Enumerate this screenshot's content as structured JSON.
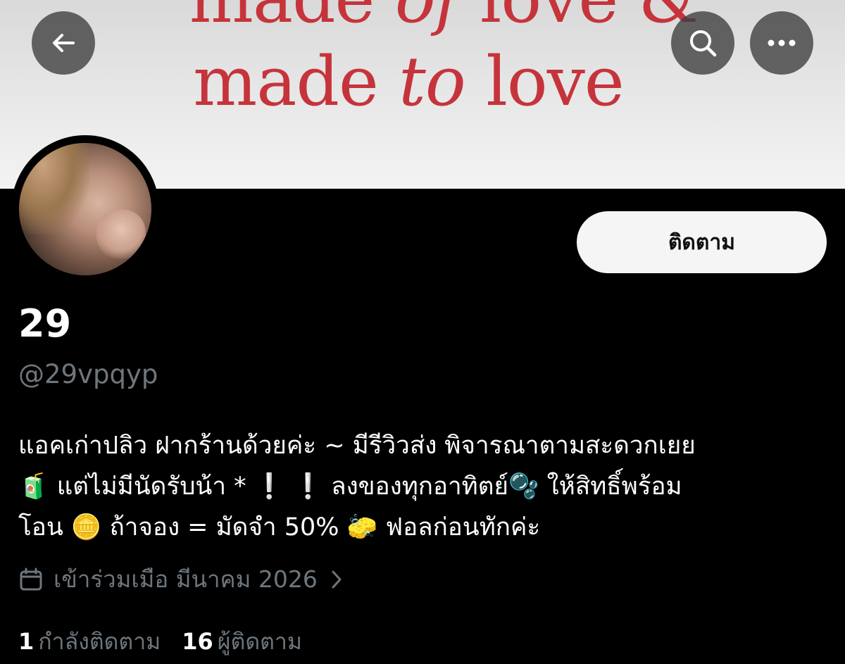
{
  "banner": {
    "line1_a": "made ",
    "line1_b": "of",
    "line1_c": " love &",
    "line2_a": "made ",
    "line2_b": "to",
    "line2_c": " love",
    "text_color": "#c6343b"
  },
  "profile": {
    "display_name": "29",
    "handle": "@29vpqyp",
    "follow_label": "ติดตาม",
    "bio_lines": [
      "แอคเก่าปลิว ฝากร้านด้วยค่ะ ~ มีรีวิวส่ง พิจารณาตามสะดวกเยย",
      "🧃 แต่ไม่มีนัดรับน้า * ❕ ❕ ลงของทุกอาทิตย์🫧 ให้สิทธิ์พร้อม",
      "โอน 🪙 ถ้าจอง = มัดจำ 50% 🧽 ฟอลก่อนทักค่ะ"
    ],
    "joined": "เข้าร่วมเมือ มีนาคม 2026",
    "following_count": "1",
    "following_label": "กำลังติดตาม",
    "followers_count": "16",
    "followers_label": "ผู้ติดตาม"
  },
  "icons": {
    "back": "arrow-left-icon",
    "search": "search-icon",
    "more": "more-horizontal-icon",
    "calendar": "calendar-icon",
    "chevron": "chevron-right-icon"
  },
  "colors": {
    "background": "#000000",
    "secondary_text": "#6e767d",
    "follow_button_bg": "#f5f5f5"
  }
}
